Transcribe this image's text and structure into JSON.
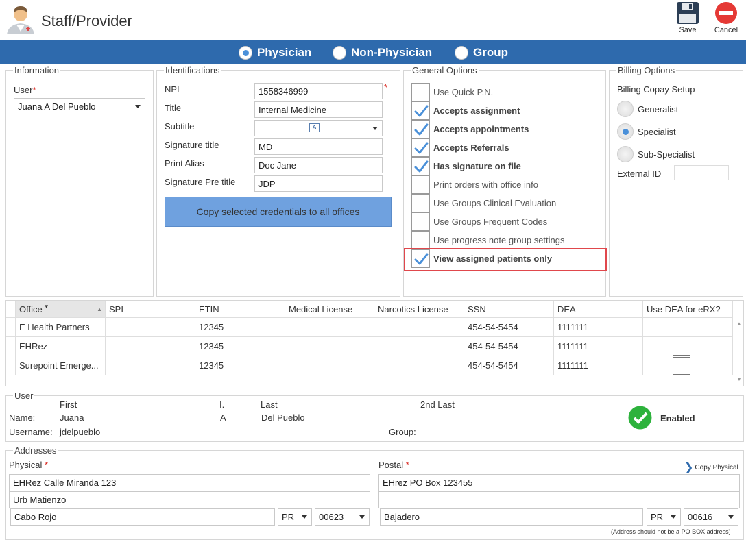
{
  "header": {
    "title": "Staff/Provider",
    "save_label": "Save",
    "cancel_label": "Cancel"
  },
  "type_options": [
    {
      "label": "Physician",
      "selected": true
    },
    {
      "label": "Non-Physician",
      "selected": false
    },
    {
      "label": "Group",
      "selected": false
    }
  ],
  "information": {
    "legend": "Information",
    "user_label": "User",
    "user_value": "Juana A Del Pueblo"
  },
  "identifications": {
    "legend": "Identifications",
    "npi_label": "NPI",
    "npi_value": "1558346999",
    "title_label": "Title",
    "title_value": "Internal Medicine",
    "subtitle_label": "Subtitle",
    "subtitle_value": "",
    "sig_title_label": "Signature title",
    "sig_title_value": "MD",
    "print_alias_label": "Print Alias",
    "print_alias_value": "Doc Jane",
    "sig_pre_label": "Signature Pre title",
    "sig_pre_value": "JDP",
    "copy_button": "Copy selected credentials to all offices"
  },
  "general_options": {
    "legend": "General Options",
    "items": [
      {
        "label": "Use Quick P.N.",
        "checked": false
      },
      {
        "label": "Accepts assignment",
        "checked": true
      },
      {
        "label": "Accepts appointments",
        "checked": true
      },
      {
        "label": "Accepts Referrals",
        "checked": true
      },
      {
        "label": "Has signature on file",
        "checked": true
      },
      {
        "label": "Print orders with office info",
        "checked": false
      },
      {
        "label": "Use Groups Clinical Evaluation",
        "checked": false
      },
      {
        "label": "Use Groups Frequent Codes",
        "checked": false
      },
      {
        "label": "Use progress note group settings",
        "checked": false
      },
      {
        "label": "View assigned patients only",
        "checked": true
      }
    ],
    "highlight_color": "#e0474c"
  },
  "billing": {
    "legend": "Billing Options",
    "copay_label": "Billing Copay Setup",
    "options": [
      {
        "label": "Generalist",
        "selected": false
      },
      {
        "label": "Specialist",
        "selected": true
      },
      {
        "label": "Sub-Specialist",
        "selected": false
      }
    ],
    "external_id_label": "External ID",
    "external_id_value": ""
  },
  "offices_grid": {
    "columns": [
      "Office",
      "SPI",
      "ETIN",
      "Medical License",
      "Narcotics License",
      "SSN",
      "DEA",
      "Use DEA for eRX?"
    ],
    "rows": [
      {
        "office": "E Health Partners",
        "spi": "",
        "etin": "12345",
        "medical": "",
        "narcotics": "",
        "ssn": "454-54-5454",
        "dea": "1111111"
      },
      {
        "office": "EHRez",
        "spi": "",
        "etin": "12345",
        "medical": "",
        "narcotics": "",
        "ssn": "454-54-5454",
        "dea": "1111111"
      },
      {
        "office": "Surepoint Emerge...",
        "spi": "",
        "etin": "12345",
        "medical": "",
        "narcotics": "",
        "ssn": "454-54-5454",
        "dea": "1111111"
      }
    ]
  },
  "user_section": {
    "legend": "User",
    "first_label": "First",
    "initial_label": "I.",
    "last_label": "Last",
    "second_last_label": "2nd Last",
    "name_label": "Name:",
    "first": "Juana",
    "initial": "A",
    "last": "Del Pueblo",
    "second_last": "",
    "username_label": "Username:",
    "username": "jdelpueblo",
    "group_label": "Group:",
    "group": "",
    "status": "Enabled",
    "status_color": "#2db23c"
  },
  "addresses": {
    "legend": "Addresses",
    "physical_label": "Physical",
    "postal_label": "Postal",
    "copy_physical": "Copy Physical",
    "physical": {
      "line1": "EHRez Calle Miranda 123",
      "line2": "Urb Matienzo",
      "city": "Cabo Rojo",
      "state": "PR",
      "zip": "00623"
    },
    "postal": {
      "line1": "EHrez PO Box 123455",
      "line2": "",
      "city": "Bajadero",
      "state": "PR",
      "zip": "00616"
    },
    "note": "(Address should not be a PO BOX address)"
  }
}
